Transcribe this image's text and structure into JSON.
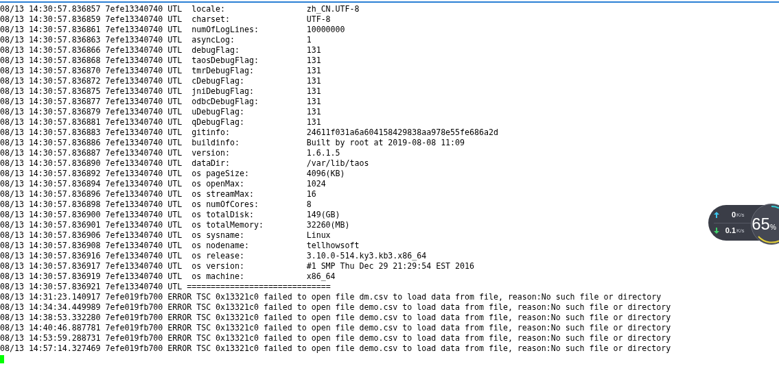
{
  "log_lines": [
    {
      "kind": "setting",
      "prefix": "08/13 14:30:57.836857 7efe13340740 UTL",
      "key": "locale:",
      "value": "zh_CN.UTF-8"
    },
    {
      "kind": "setting",
      "prefix": "08/13 14:30:57.836859 7efe13340740 UTL",
      "key": "charset:",
      "value": "UTF-8"
    },
    {
      "kind": "setting",
      "prefix": "08/13 14:30:57.836861 7efe13340740 UTL",
      "key": "numOfLogLines:",
      "value": "10000000"
    },
    {
      "kind": "setting",
      "prefix": "08/13 14:30:57.836863 7efe13340740 UTL",
      "key": "asyncLog:",
      "value": "1"
    },
    {
      "kind": "setting",
      "prefix": "08/13 14:30:57.836866 7efe13340740 UTL",
      "key": "debugFlag:",
      "value": "131"
    },
    {
      "kind": "setting",
      "prefix": "08/13 14:30:57.836868 7efe13340740 UTL",
      "key": "taosDebugFlag:",
      "value": "131"
    },
    {
      "kind": "setting",
      "prefix": "08/13 14:30:57.836870 7efe13340740 UTL",
      "key": "tmrDebugFlag:",
      "value": "131"
    },
    {
      "kind": "setting",
      "prefix": "08/13 14:30:57.836872 7efe13340740 UTL",
      "key": "cDebugFlag:",
      "value": "131"
    },
    {
      "kind": "setting",
      "prefix": "08/13 14:30:57.836875 7efe13340740 UTL",
      "key": "jniDebugFlag:",
      "value": "131"
    },
    {
      "kind": "setting",
      "prefix": "08/13 14:30:57.836877 7efe13340740 UTL",
      "key": "odbcDebugFlag:",
      "value": "131"
    },
    {
      "kind": "setting",
      "prefix": "08/13 14:30:57.836879 7efe13340740 UTL",
      "key": "uDebugFlag:",
      "value": "131"
    },
    {
      "kind": "setting",
      "prefix": "08/13 14:30:57.836881 7efe13340740 UTL",
      "key": "qDebugFlag:",
      "value": "131"
    },
    {
      "kind": "setting",
      "prefix": "08/13 14:30:57.836883 7efe13340740 UTL",
      "key": "gitinfo:",
      "value": "24611f031a6a604158429838aa978e55fe686a2d"
    },
    {
      "kind": "setting",
      "prefix": "08/13 14:30:57.836886 7efe13340740 UTL",
      "key": "buildinfo:",
      "value": "Built by root at 2019-08-08 11:09"
    },
    {
      "kind": "setting",
      "prefix": "08/13 14:30:57.836887 7efe13340740 UTL",
      "key": "version:",
      "value": "1.6.1.5"
    },
    {
      "kind": "setting",
      "prefix": "08/13 14:30:57.836890 7efe13340740 UTL",
      "key": "dataDir:",
      "value": "/var/lib/taos"
    },
    {
      "kind": "setting",
      "prefix": "08/13 14:30:57.836892 7efe13340740 UTL",
      "key": "os pageSize:",
      "value": "4096(KB)"
    },
    {
      "kind": "setting",
      "prefix": "08/13 14:30:57.836894 7efe13340740 UTL",
      "key": "os openMax:",
      "value": "1024"
    },
    {
      "kind": "setting",
      "prefix": "08/13 14:30:57.836896 7efe13340740 UTL",
      "key": "os streamMax:",
      "value": "16"
    },
    {
      "kind": "setting",
      "prefix": "08/13 14:30:57.836898 7efe13340740 UTL",
      "key": "os numOfCores:",
      "value": "8"
    },
    {
      "kind": "setting",
      "prefix": "08/13 14:30:57.836900 7efe13340740 UTL",
      "key": "os totalDisk:",
      "value": "149(GB)"
    },
    {
      "kind": "setting",
      "prefix": "08/13 14:30:57.836901 7efe13340740 UTL",
      "key": "os totalMemory:",
      "value": "32260(MB)"
    },
    {
      "kind": "setting",
      "prefix": "08/13 14:30:57.836906 7efe13340740 UTL",
      "key": "os sysname:",
      "value": "Linux"
    },
    {
      "kind": "setting",
      "prefix": "08/13 14:30:57.836908 7efe13340740 UTL",
      "key": "os nodename:",
      "value": "tellhowsoft"
    },
    {
      "kind": "setting",
      "prefix": "08/13 14:30:57.836916 7efe13340740 UTL",
      "key": "os release:",
      "value": "3.10.0-514.ky3.kb3.x86_64"
    },
    {
      "kind": "setting",
      "prefix": "08/13 14:30:57.836917 7efe13340740 UTL",
      "key": "os version:",
      "value": "#1 SMP Thu Dec 29 21:29:54 EST 2016"
    },
    {
      "kind": "setting",
      "prefix": "08/13 14:30:57.836919 7efe13340740 UTL",
      "key": "os machine:",
      "value": "x86_64"
    },
    {
      "kind": "plain",
      "text": "08/13 14:30:57.836921 7efe13340740 UTL =============================="
    },
    {
      "kind": "plain",
      "text": "08/13 14:31:23.140917 7efe019fb700 ERROR TSC 0x13321c0 failed to open file dm.csv to load data from file, reason:No such file or directory"
    },
    {
      "kind": "plain",
      "text": "08/13 14:34:34.449989 7efe019fb700 ERROR TSC 0x13321c0 failed to open file demo.csv to load data from file, reason:No such file or directory"
    },
    {
      "kind": "plain",
      "text": "08/13 14:38:53.332280 7efe019fb700 ERROR TSC 0x13321c0 failed to open file demo.csv to load data from file, reason:No such file or directory"
    },
    {
      "kind": "plain",
      "text": "08/13 14:40:46.887781 7efe019fb700 ERROR TSC 0x13321c0 failed to open file demo.csv to load data from file, reason:No such file or directory"
    },
    {
      "kind": "plain",
      "text": "08/13 14:53:59.288731 7efe019fb700 ERROR TSC 0x13321c0 failed to open file demo.csv to load data from file, reason:No such file or directory"
    },
    {
      "kind": "plain",
      "text": "08/13 14:57:14.327469 7efe019fb700 ERROR TSC 0x13321c0 failed to open file demo.csv to load data from file, reason:No such file or directory"
    }
  ],
  "speed_widget": {
    "upload": {
      "value": "0",
      "unit": "K/s"
    },
    "download": {
      "value": "0.1",
      "unit": "K/s"
    },
    "usage": {
      "value": "65",
      "unit": "%"
    }
  }
}
